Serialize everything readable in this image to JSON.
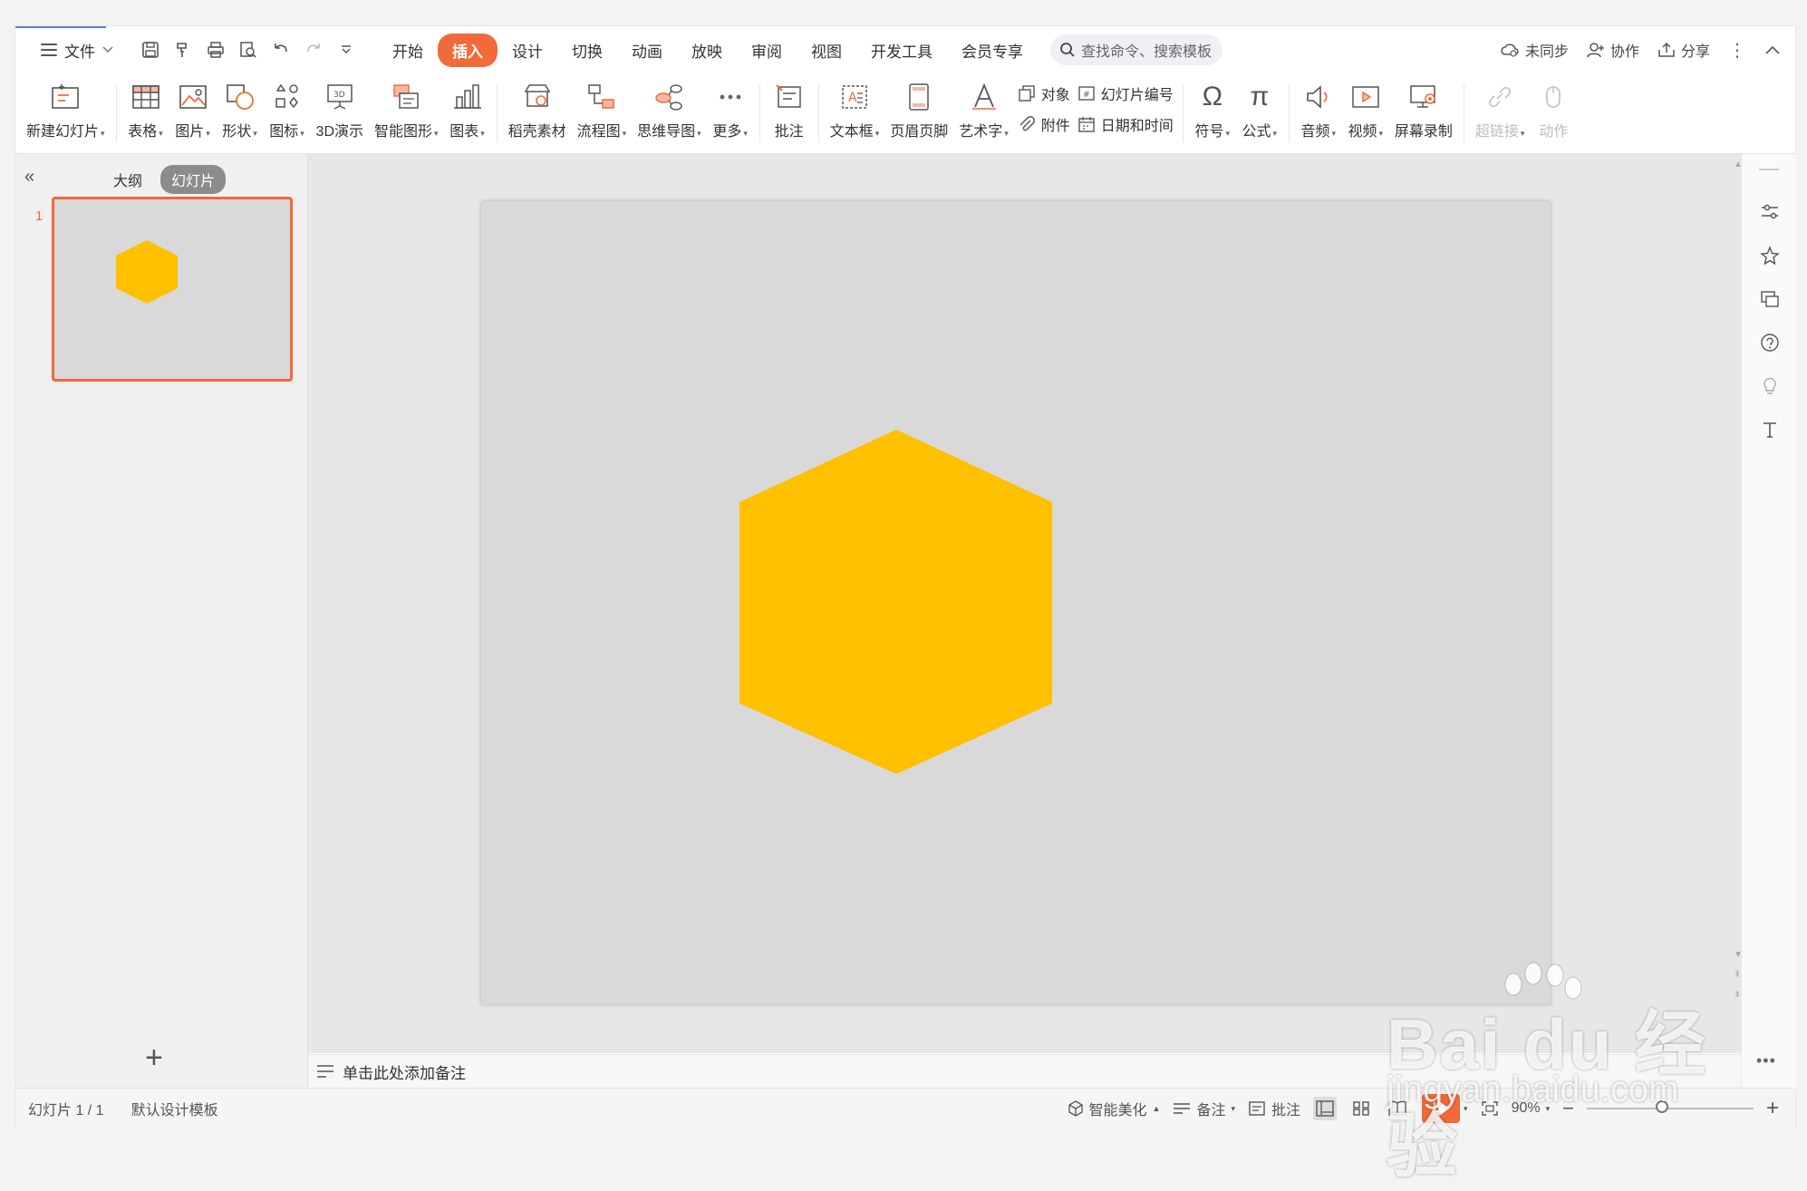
{
  "menu": {
    "file_label": "文件",
    "tabs": [
      {
        "label": "开始"
      },
      {
        "label": "插入"
      },
      {
        "label": "设计"
      },
      {
        "label": "切换"
      },
      {
        "label": "动画"
      },
      {
        "label": "放映"
      },
      {
        "label": "审阅"
      },
      {
        "label": "视图"
      },
      {
        "label": "开发工具"
      },
      {
        "label": "会员专享"
      }
    ],
    "active_tab": "插入",
    "search_placeholder": "查找命令、搜索模板",
    "right": {
      "sync": "未同步",
      "collab": "协作",
      "share": "分享"
    }
  },
  "ribbon": {
    "new_slide": "新建幻灯片",
    "table": "表格",
    "picture": "图片",
    "shape": "形状",
    "icon": "图标",
    "demo3d": "3D演示",
    "smartart": "智能图形",
    "chart": "图表",
    "material": "稻壳素材",
    "flowchart": "流程图",
    "mindmap": "思维导图",
    "more": "更多",
    "comment": "批注",
    "textbox": "文本框",
    "header_footer": "页眉页脚",
    "wordart": "艺术字",
    "object": "对象",
    "attachment": "附件",
    "slide_number": "幻灯片编号",
    "datetime": "日期和时间",
    "symbol": "符号",
    "formula": "公式",
    "audio": "音频",
    "video": "视频",
    "screen_record": "屏幕录制",
    "hyperlink": "超链接",
    "action": "动作"
  },
  "left_panel": {
    "tab_outline": "大纲",
    "tab_slides": "幻灯片",
    "slide_number": "1",
    "add_symbol": "+"
  },
  "slide": {
    "shape": "hexagon",
    "shape_color": "#ffc000",
    "background_color": "#d9d9d9"
  },
  "notes": {
    "placeholder": "单击此处添加备注"
  },
  "status": {
    "slide_info": "幻灯片 1 / 1",
    "template": "默认设计模板",
    "smart_beautify": "智能美化",
    "notes": "备注",
    "comment": "批注",
    "zoom": "90%",
    "zoom_level": 0.45
  },
  "watermark": {
    "main": "Bai du 经验",
    "url": "jingyan.baidu.com"
  },
  "colors": {
    "accent": "#f06a3a",
    "hexagon": "#ffc000"
  }
}
